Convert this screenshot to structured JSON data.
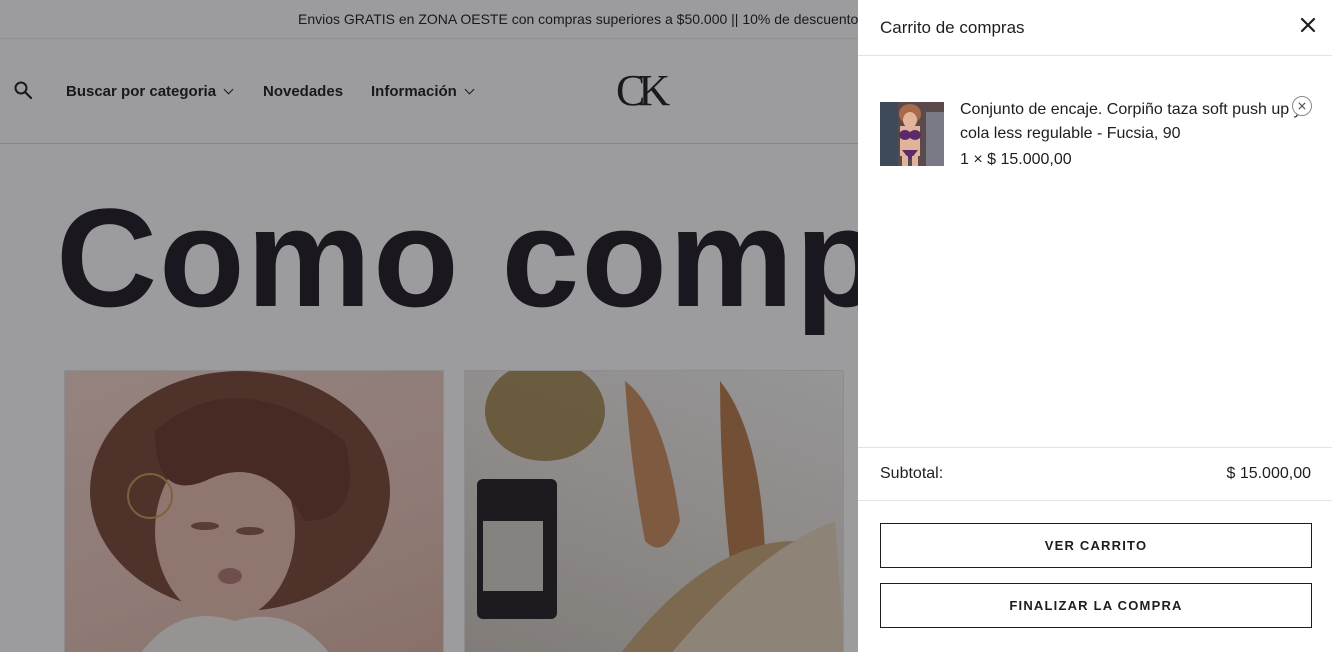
{
  "announcement": "Envios GRATIS en ZONA OESTE con compras superiores a $50.000 || 10% de descuento",
  "header": {
    "search_icon": "search-icon",
    "nav": [
      {
        "label": "Buscar por categoria",
        "has_dropdown": true
      },
      {
        "label": "Novedades",
        "has_dropdown": false
      },
      {
        "label": "Información",
        "has_dropdown": true
      }
    ],
    "logo": "CK"
  },
  "hero": {
    "title": "Como comp"
  },
  "cart": {
    "title": "Carrito de compras",
    "close_icon": "close-icon",
    "items": [
      {
        "name": "Conjunto de encaje. Corpiño taza soft push up y cola less regulable - Fucsia, 90",
        "quantity_price": "1 × $ 15.000,00",
        "remove_icon": "remove-circle-icon"
      }
    ],
    "subtotal_label": "Subtotal:",
    "subtotal_value": "$ 15.000,00",
    "view_cart_label": "VER CARRITO",
    "checkout_label": "FINALIZAR LA COMPRA"
  },
  "colors": {
    "text": "#1f1d23",
    "overlay": "rgba(20,18,24,0.42)",
    "drawer_bg": "#ffffff",
    "border": "#e3e3e3"
  }
}
